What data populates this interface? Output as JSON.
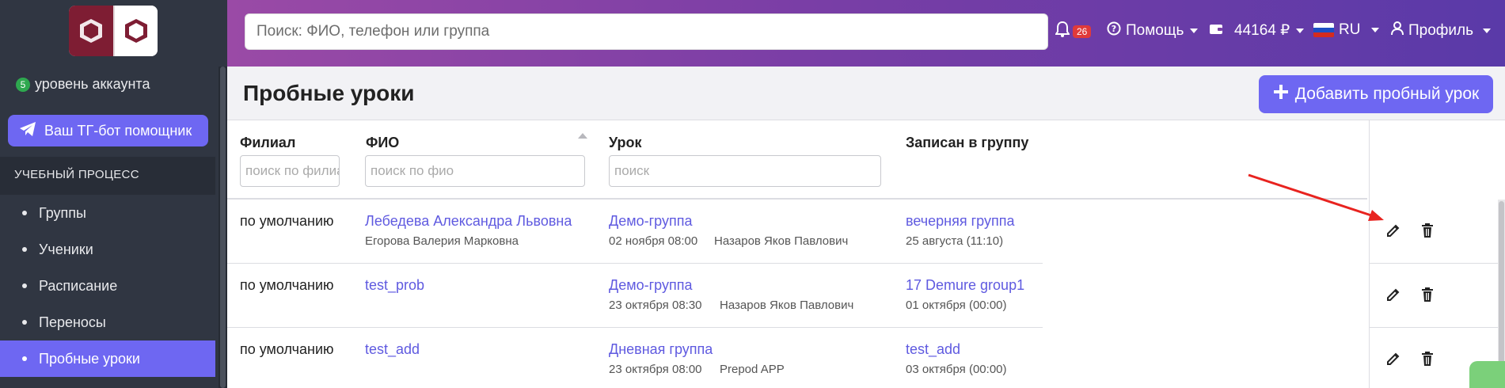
{
  "sidebar": {
    "level_count": "5",
    "level_label": "уровень аккаунта",
    "tg_button": "Ваш ТГ-бот помощник",
    "section_title": "УЧЕБНЫЙ ПРОЦЕСС",
    "items": [
      {
        "label": "Группы",
        "active": false
      },
      {
        "label": "Ученики",
        "active": false
      },
      {
        "label": "Расписание",
        "active": false
      },
      {
        "label": "Переносы",
        "active": false
      },
      {
        "label": "Пробные уроки",
        "active": true
      }
    ]
  },
  "header": {
    "search_placeholder": "Поиск: ФИО, телефон или группа",
    "notifications_count": "26",
    "help_label": "Помощь",
    "balance": "44164 ₽",
    "language": "RU",
    "profile_label": "Профиль"
  },
  "page": {
    "title": "Пробные уроки",
    "add_button": "Добавить пробный урок"
  },
  "table": {
    "columns": [
      {
        "label": "Филиал",
        "filter_placeholder": "поиск по филиалу"
      },
      {
        "label": "ФИО",
        "filter_placeholder": "поиск по фио"
      },
      {
        "label": "Урок",
        "filter_placeholder": "поиск"
      },
      {
        "label": "Записан в группу"
      }
    ],
    "rows": [
      {
        "branch": "по умолчанию",
        "name": "Лебедева Александра Львовна",
        "parent": "Егорова Валерия Марковна",
        "lesson": "Демо-группа",
        "lesson_date": "02 ноября 08:00",
        "teacher": "Назаров Яков Павлович",
        "group": "вечерняя группа",
        "group_date": "25 августа (11:10)"
      },
      {
        "branch": "по умолчанию",
        "name": "test_prob",
        "parent": "",
        "lesson": "Демо-группа",
        "lesson_date": "23 октября 08:30",
        "teacher": "Назаров Яков Павлович",
        "group": "17 Demure group1",
        "group_date": "01 октября (00:00)"
      },
      {
        "branch": "по умолчанию",
        "name": "test_add",
        "parent": "",
        "lesson": "Дневная группа",
        "lesson_date": "23 октября 08:00",
        "teacher": "Prepod APP",
        "group": "test_add",
        "group_date": "03 октября (00:00)"
      }
    ]
  },
  "colors": {
    "accent": "#6e67f2",
    "sidebar_bg": "#303642",
    "link": "#5f5ae0",
    "annotation_arrow": "#e8231f"
  },
  "icons": [
    "telegram-icon",
    "bell-icon",
    "help-circle-icon",
    "wallet-icon",
    "flag-ru-icon",
    "user-icon",
    "plus-icon",
    "pencil-icon",
    "trash-icon"
  ]
}
